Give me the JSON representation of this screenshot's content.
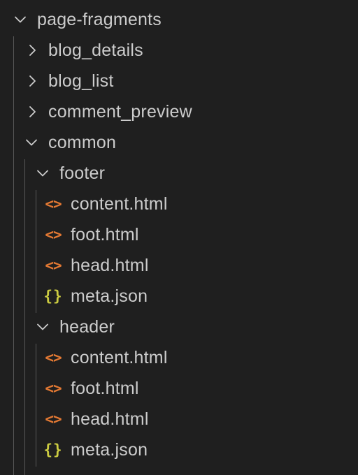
{
  "explorer": {
    "root": {
      "label": "page-fragments",
      "expanded": true
    },
    "folders": [
      {
        "label": "blog_details",
        "expanded": false
      },
      {
        "label": "blog_list",
        "expanded": false
      },
      {
        "label": "comment_preview",
        "expanded": false
      },
      {
        "label": "common",
        "expanded": true
      }
    ],
    "footer": {
      "label": "footer",
      "expanded": true,
      "files": [
        {
          "label": "content.html",
          "icon": "html-file-icon"
        },
        {
          "label": "foot.html",
          "icon": "html-file-icon"
        },
        {
          "label": "head.html",
          "icon": "html-file-icon"
        },
        {
          "label": "meta.json",
          "icon": "json-file-icon"
        }
      ]
    },
    "header": {
      "label": "header",
      "expanded": true,
      "files": [
        {
          "label": "content.html",
          "icon": "html-file-icon"
        },
        {
          "label": "foot.html",
          "icon": "html-file-icon"
        },
        {
          "label": "head.html",
          "icon": "html-file-icon"
        },
        {
          "label": "meta.json",
          "icon": "json-file-icon"
        }
      ]
    },
    "icons": {
      "html_glyph": "<>",
      "json_glyph": "{}"
    },
    "colors": {
      "background": "#1f1f1f",
      "text": "#cccccc",
      "html_icon": "#e37933",
      "json_icon": "#cbcb41",
      "indent_guide": "#585858"
    }
  }
}
